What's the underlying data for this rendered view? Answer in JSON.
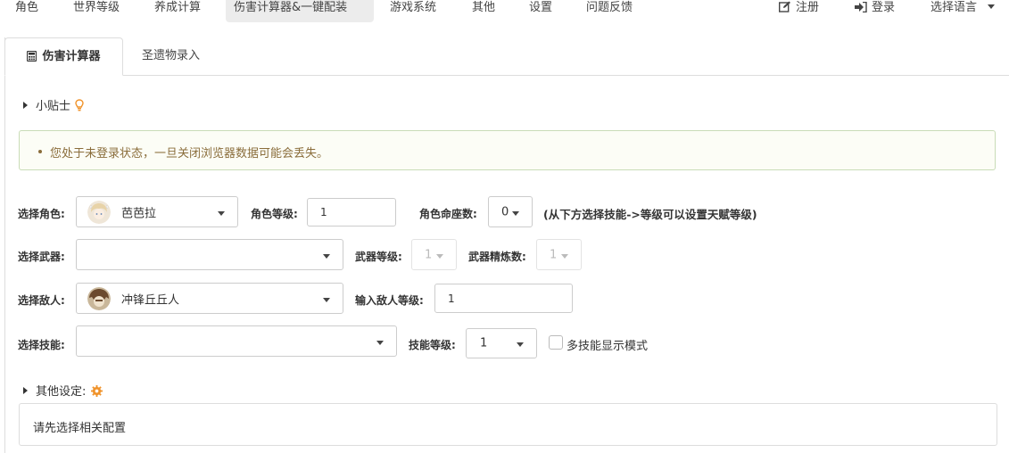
{
  "nav": {
    "items": [
      "角色",
      "世界等级",
      "养成计算",
      "伤害计算器&一键配装",
      "游戏系统",
      "其他",
      "设置",
      "问题反馈"
    ],
    "register": "注册",
    "login": "登录",
    "language": "选择语言"
  },
  "tabs": {
    "damage_calc": "伤害计算器",
    "artifact_entry": "圣遗物录入"
  },
  "tips": {
    "label": "小贴士"
  },
  "alert": {
    "message": "您处于未登录状态，一旦关闭浏览器数据可能会丢失。"
  },
  "form": {
    "character_label": "选择角色:",
    "character_value": "芭芭拉",
    "char_level_label": "角色等级:",
    "char_level_value": "1",
    "constellation_label": "角色命座数:",
    "constellation_value": "0",
    "constellation_hint": "(从下方选择技能->等级可以设置天赋等级)",
    "weapon_label": "选择武器:",
    "weapon_value": "",
    "weapon_level_label": "武器等级:",
    "weapon_level_value": "1",
    "refine_label": "武器精炼数:",
    "refine_value": "1",
    "enemy_label": "选择敌人:",
    "enemy_value": "冲锋丘丘人",
    "enemy_level_label": "输入敌人等级:",
    "enemy_level_value": "1",
    "skill_label": "选择技能:",
    "skill_value": "",
    "skill_level_label": "技能等级:",
    "skill_level_value": "1",
    "multi_skill_label": "多技能显示模式"
  },
  "other_settings": {
    "label": "其他设定:"
  },
  "bottom": {
    "message": "请先选择相关配置"
  },
  "colors": {
    "accent_orange": "#f0932b",
    "alert_text": "#8a6d3b",
    "alert_border": "#c9dcb7"
  }
}
